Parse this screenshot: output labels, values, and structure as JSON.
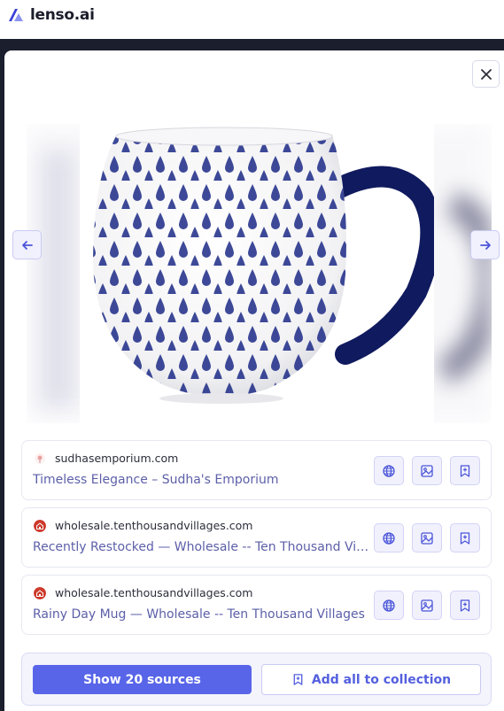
{
  "app": {
    "name": "lenso.ai"
  },
  "colors": {
    "accent": "#5865e8",
    "accent_text": "#5460de",
    "link_text": "#5c5fa8",
    "backdrop": "#1b1e2c"
  },
  "modal": {
    "close_icon": "close-icon",
    "prev_icon": "arrow-left-icon",
    "next_icon": "arrow-right-icon",
    "image_description": "White ceramic mug with blue raindrop pattern and dark blue handle"
  },
  "results": [
    {
      "domain": "sudhasemporium.com",
      "title": "Timeless Elegance – Sudha's Emporium",
      "favicon": "flower-favicon"
    },
    {
      "domain": "wholesale.tenthousandvillages.com",
      "title": "Recently Restocked — Wholesale -- Ten Thousand Villages",
      "favicon": "home-favicon"
    },
    {
      "domain": "wholesale.tenthousandvillages.com",
      "title": "Rainy Day Mug — Wholesale -- Ten Thousand Villages",
      "favicon": "home-favicon"
    }
  ],
  "result_actions": [
    "globe-icon",
    "image-icon",
    "bookmark-plus-icon"
  ],
  "footer": {
    "show_sources_label": "Show 20 sources",
    "add_collection_label": "Add all to collection"
  }
}
